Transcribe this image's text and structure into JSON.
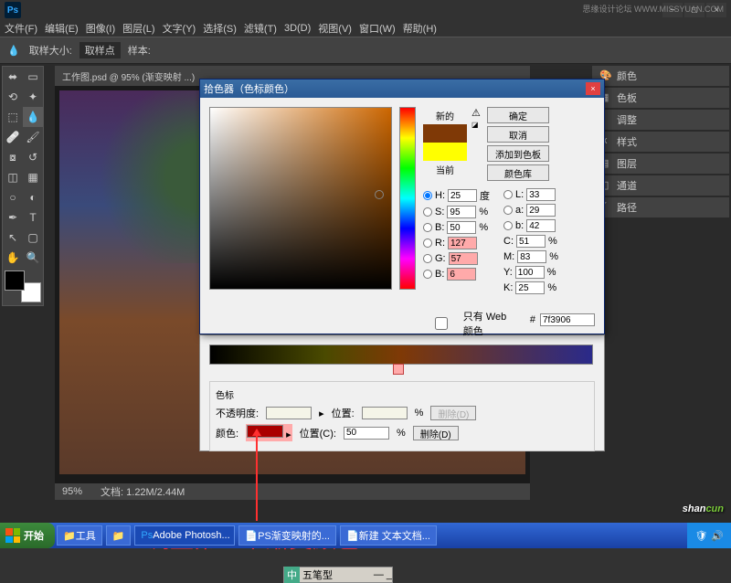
{
  "app": {
    "name": "Ps"
  },
  "menu": [
    "文件(F)",
    "编辑(E)",
    "图像(I)",
    "图层(L)",
    "文字(Y)",
    "选择(S)",
    "滤镜(T)",
    "3D(D)",
    "视图(V)",
    "窗口(W)",
    "帮助(H)"
  ],
  "optbar": {
    "label1": "取样大小:",
    "value1": "取样点",
    "label2": "样本:"
  },
  "watermark1": "思缘设计论坛  WWW.MISSYUAN.COM",
  "tab": "工作图.psd @ 95% (渐变映射 ...)",
  "status": {
    "zoom": "95%",
    "docinfo": "文档: 1.22M/2.44M"
  },
  "rpanels": [
    "颜色",
    "色板",
    "调整",
    "样式",
    "图层",
    "通道",
    "路径"
  ],
  "colorpicker": {
    "title": "拾色器（色标颜色）",
    "new_label": "新的",
    "cur_label": "当前",
    "buttons": {
      "ok": "确定",
      "cancel": "取消",
      "add": "添加到色板",
      "lib": "颜色库"
    },
    "webonly": "只有 Web 颜色",
    "hsb": {
      "H": "25",
      "S": "95",
      "B": "50",
      "H_unit": "度",
      "pct": "%"
    },
    "lab": {
      "L": "33",
      "a": "29",
      "b": "42"
    },
    "rgb": {
      "R": "127",
      "G": "57",
      "B": "6"
    },
    "cmyk": {
      "C": "51",
      "M": "83",
      "Y": "100",
      "K": "25"
    },
    "hex": "7f3906"
  },
  "gradient": {
    "section": "色标",
    "opacity_label": "不透明度:",
    "pos_label": "位置:",
    "pos_label2": "位置(C):",
    "color_label": "颜色:",
    "delete": "删除(D)",
    "pos_value": "50",
    "pct": "%"
  },
  "annotation": "调整第二个渐变颜色",
  "ime": "五笔型",
  "taskbar": {
    "start": "开始",
    "tasks": [
      "工具",
      "",
      "Adobe Photosh...",
      "PS渐变映射的...",
      "新建 文本文档..."
    ]
  },
  "watermark2": {
    "a": "shan",
    "b": "cun"
  }
}
